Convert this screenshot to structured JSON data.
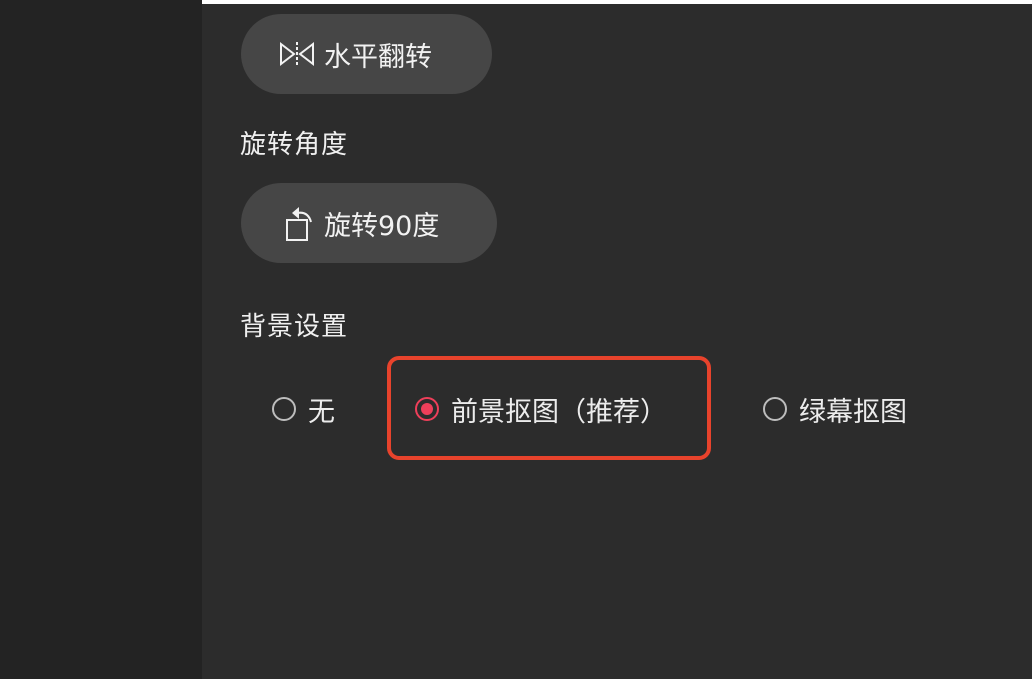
{
  "flip_button": {
    "label": "水平翻转",
    "icon": "flip-horizontal-icon"
  },
  "rotate_section": {
    "title": "旋转角度",
    "button_label": "旋转90度",
    "icon": "rotate-icon"
  },
  "background_section": {
    "title": "背景设置",
    "options": [
      {
        "label": "无",
        "selected": false
      },
      {
        "label": "前景抠图（推荐）",
        "selected": true
      },
      {
        "label": "绿幕抠图",
        "selected": false
      }
    ]
  },
  "colors": {
    "accent": "#ee3f5a",
    "highlight_border": "#e8432c",
    "button_bg": "#464646",
    "panel_bg": "#2c2c2c",
    "sidebar_bg": "#232323"
  }
}
